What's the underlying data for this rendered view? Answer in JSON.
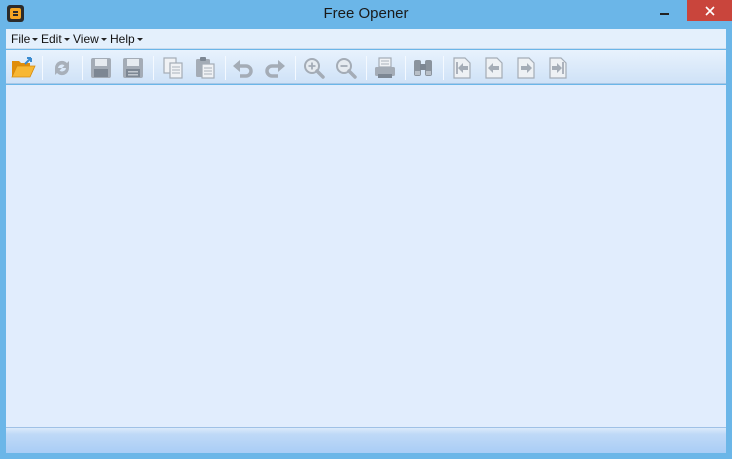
{
  "window": {
    "title": "Free Opener"
  },
  "menu": [
    {
      "label": "File"
    },
    {
      "label": "Edit"
    },
    {
      "label": "View"
    },
    {
      "label": "Help"
    }
  ],
  "toolbar": {
    "buttons": [
      {
        "icon": "open-folder-icon",
        "enabled": true
      },
      {
        "icon": "refresh-icon",
        "enabled": false
      },
      {
        "icon": "save-icon",
        "enabled": false
      },
      {
        "icon": "save-as-icon",
        "enabled": false
      },
      {
        "icon": "copy-icon",
        "enabled": false
      },
      {
        "icon": "paste-icon",
        "enabled": false
      },
      {
        "icon": "undo-icon",
        "enabled": false
      },
      {
        "icon": "redo-icon",
        "enabled": false
      },
      {
        "icon": "zoom-in-icon",
        "enabled": false
      },
      {
        "icon": "zoom-out-icon",
        "enabled": false
      },
      {
        "icon": "print-icon",
        "enabled": false
      },
      {
        "icon": "find-icon",
        "enabled": false
      },
      {
        "icon": "first-page-icon",
        "enabled": false
      },
      {
        "icon": "previous-page-icon",
        "enabled": false
      },
      {
        "icon": "next-page-icon",
        "enabled": false
      },
      {
        "icon": "last-page-icon",
        "enabled": false
      }
    ]
  },
  "colors": {
    "frame": "#6bb6e8",
    "close_button": "#c9453c",
    "content_background": "#e1edfd",
    "disabled_icon": "#a4acb6",
    "folder_icon": "#f4a41e"
  }
}
